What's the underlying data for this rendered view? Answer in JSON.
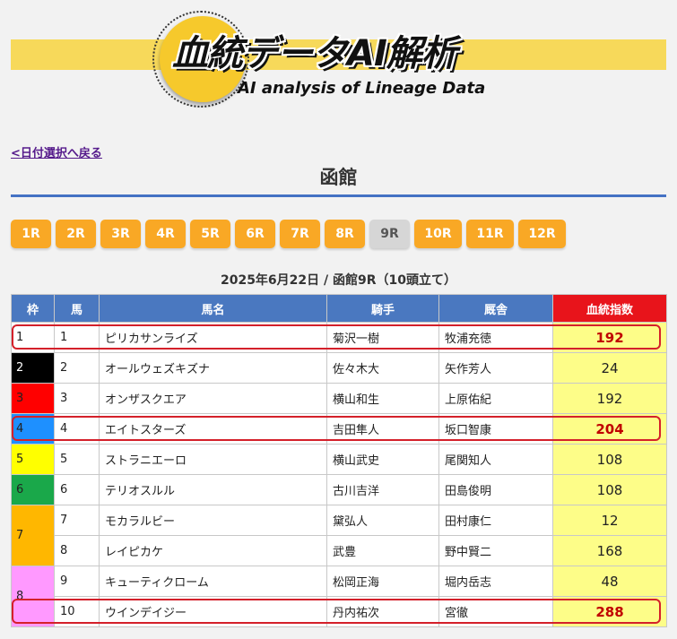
{
  "header": {
    "logo_title": "血統データAI解析",
    "logo_subtitle": "AI analysis of Lineage Data"
  },
  "nav": {
    "back_link": "<日付選択へ戻る"
  },
  "venue": "函館",
  "races": [
    {
      "label": "1R",
      "active": false
    },
    {
      "label": "2R",
      "active": false
    },
    {
      "label": "3R",
      "active": false
    },
    {
      "label": "4R",
      "active": false
    },
    {
      "label": "5R",
      "active": false
    },
    {
      "label": "6R",
      "active": false
    },
    {
      "label": "7R",
      "active": false
    },
    {
      "label": "8R",
      "active": false
    },
    {
      "label": "9R",
      "active": true
    },
    {
      "label": "10R",
      "active": false
    },
    {
      "label": "11R",
      "active": false
    },
    {
      "label": "12R",
      "active": false
    }
  ],
  "race_info": "2025年6月22日 / 函館9R（10頭立て）",
  "table": {
    "headers": {
      "waku": "枠",
      "umaban": "馬",
      "horse": "馬名",
      "jockey": "騎手",
      "trainer": "厩舎",
      "index": "血統指数"
    },
    "rows": [
      {
        "waku": "1",
        "umaban": "1",
        "horse": "ピリカサンライズ",
        "jockey": "菊沢一樹",
        "trainer": "牧浦充徳",
        "index": "192",
        "highlight": true
      },
      {
        "waku": "2",
        "umaban": "2",
        "horse": "オールウェズキズナ",
        "jockey": "佐々木大",
        "trainer": "矢作芳人",
        "index": "24",
        "highlight": false
      },
      {
        "waku": "3",
        "umaban": "3",
        "horse": "オンザスクエア",
        "jockey": "横山和生",
        "trainer": "上原佑紀",
        "index": "192",
        "highlight": false
      },
      {
        "waku": "4",
        "umaban": "4",
        "horse": "エイトスターズ",
        "jockey": "吉田隼人",
        "trainer": "坂口智康",
        "index": "204",
        "highlight": true
      },
      {
        "waku": "5",
        "umaban": "5",
        "horse": "ストラニエーロ",
        "jockey": "横山武史",
        "trainer": "尾関知人",
        "index": "108",
        "highlight": false
      },
      {
        "waku": "6",
        "umaban": "6",
        "horse": "テリオスルル",
        "jockey": "古川吉洋",
        "trainer": "田島俊明",
        "index": "108",
        "highlight": false
      },
      {
        "waku": "7",
        "umaban": "7",
        "horse": "モカラルビー",
        "jockey": "黛弘人",
        "trainer": "田村康仁",
        "index": "12",
        "highlight": false
      },
      {
        "waku": "",
        "umaban": "8",
        "horse": "レイピカケ",
        "jockey": "武豊",
        "trainer": "野中賢二",
        "index": "168",
        "highlight": false
      },
      {
        "waku": "8",
        "umaban": "9",
        "horse": "キューティクローム",
        "jockey": "松岡正海",
        "trainer": "堀内岳志",
        "index": "48",
        "highlight": false
      },
      {
        "waku": "",
        "umaban": "10",
        "horse": "ウインデイジー",
        "jockey": "丹内祐次",
        "trainer": "宮徹",
        "index": "288",
        "highlight": true
      }
    ]
  },
  "colors": {
    "waku_1": "#ffffff",
    "waku_2": "#000000",
    "waku_3": "#ff0000",
    "waku_4": "#1e90ff",
    "waku_5": "#ffff00",
    "waku_6": "#1aa84a",
    "waku_7": "#ffb700",
    "waku_8": "#ff99ff",
    "header_bg": "#4a78c0",
    "index_header_bg": "#e8141b",
    "index_cell_bg": "#fdfd88",
    "highlight_ring": "#d4202a",
    "race_button": "#f9a825"
  }
}
